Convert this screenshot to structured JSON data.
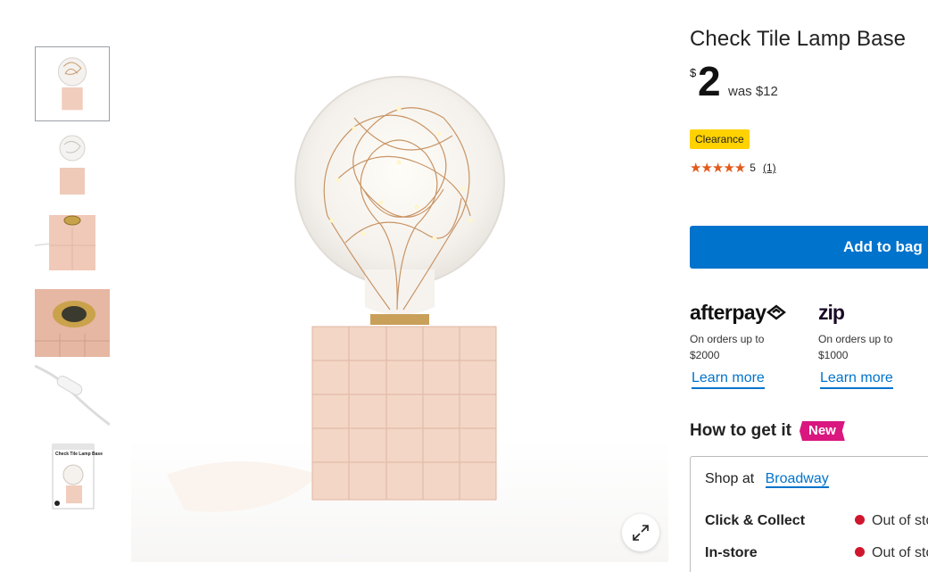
{
  "product": {
    "title": "Check Tile Lamp Base",
    "currency_symbol": "$",
    "price": "2",
    "was_price": "was $12",
    "badge": "Clearance",
    "rating_stars": "★★★★★",
    "rating_value": "5",
    "review_count": "(1)",
    "add_to_bag": "Add to bag"
  },
  "payments": {
    "afterpay": {
      "logo": "afterpay",
      "note": "On orders up to $2000",
      "link": "Learn more"
    },
    "zip": {
      "logo": "zip",
      "note": "On orders up to $1000",
      "link": "Learn more"
    }
  },
  "fulfilment": {
    "title": "How to get it",
    "new_badge": "New",
    "shop_at_label": "Shop at",
    "store": "Broadway",
    "click_collect_label": "Click & Collect",
    "click_collect_status": "Out of stock",
    "in_store_label": "In-store",
    "in_store_status": "Out of stock"
  },
  "gallery": {
    "thumbnails": [
      "front view",
      "small front view",
      "top of base",
      "socket close-up",
      "cord switch",
      "packaging"
    ],
    "packaging_text": "Check Tile Lamp Base",
    "zoom_icon": "expand-icon"
  },
  "colors": {
    "accent": "#0073cc",
    "clearance": "#ffd200",
    "new_badge": "#d9177f",
    "star": "#e25a1c",
    "out_of_stock": "#d0162e",
    "base_tile": "#f3d6c6"
  }
}
